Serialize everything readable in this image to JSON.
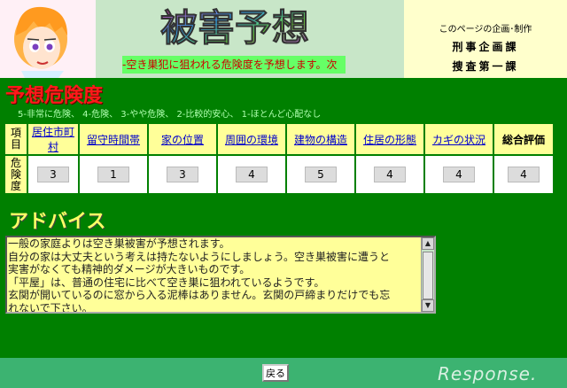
{
  "header": {
    "logo_text": "被害予想",
    "marquee": "-空き巣犯に狙われる危険度を予想します。次",
    "credit": {
      "line1": "このページの企画･制作",
      "line2": "刑事企画課",
      "line3": "捜査第一課"
    }
  },
  "risk": {
    "title": "予想危険度",
    "legend": "5-非常に危険、 4-危険、 3-やや危険、 2-比較的安心、 1-ほとんど心配なし",
    "corner_label": "項目",
    "row_label": "危険度",
    "columns": [
      "居住市町村",
      "留守時間帯",
      "家の位置",
      "周囲の環境",
      "建物の構造",
      "住居の形態",
      "カギの状況",
      "総合評価"
    ],
    "values": [
      "3",
      "1",
      "3",
      "4",
      "5",
      "4",
      "4",
      "4"
    ]
  },
  "advice": {
    "title": "アドバイス",
    "lines": [
      "一般の家庭よりは空き巣被害が予想されます。",
      "自分の家は大丈夫という考えは持たないようにしましょう。空き巣被害に遭うと",
      "実害がなくても精神的ダメージが大きいものです。",
      "「平屋」は、普通の住宅に比べて空き巣に狙われているようです。",
      "玄関が開いているのに窓から入る泥棒はありません。玄関の戸締まりだけでも忘",
      "れないで下さい。"
    ]
  },
  "footer": {
    "back_label": "戻る",
    "watermark": "Response."
  },
  "colors": {
    "main_bg": "#008000",
    "header_bg": "#c8e6c8",
    "footer_bg": "#3cb371",
    "cell_header": "#ffff99",
    "risk_title": "#ff1a1a",
    "advice_title": "#ffff66"
  }
}
